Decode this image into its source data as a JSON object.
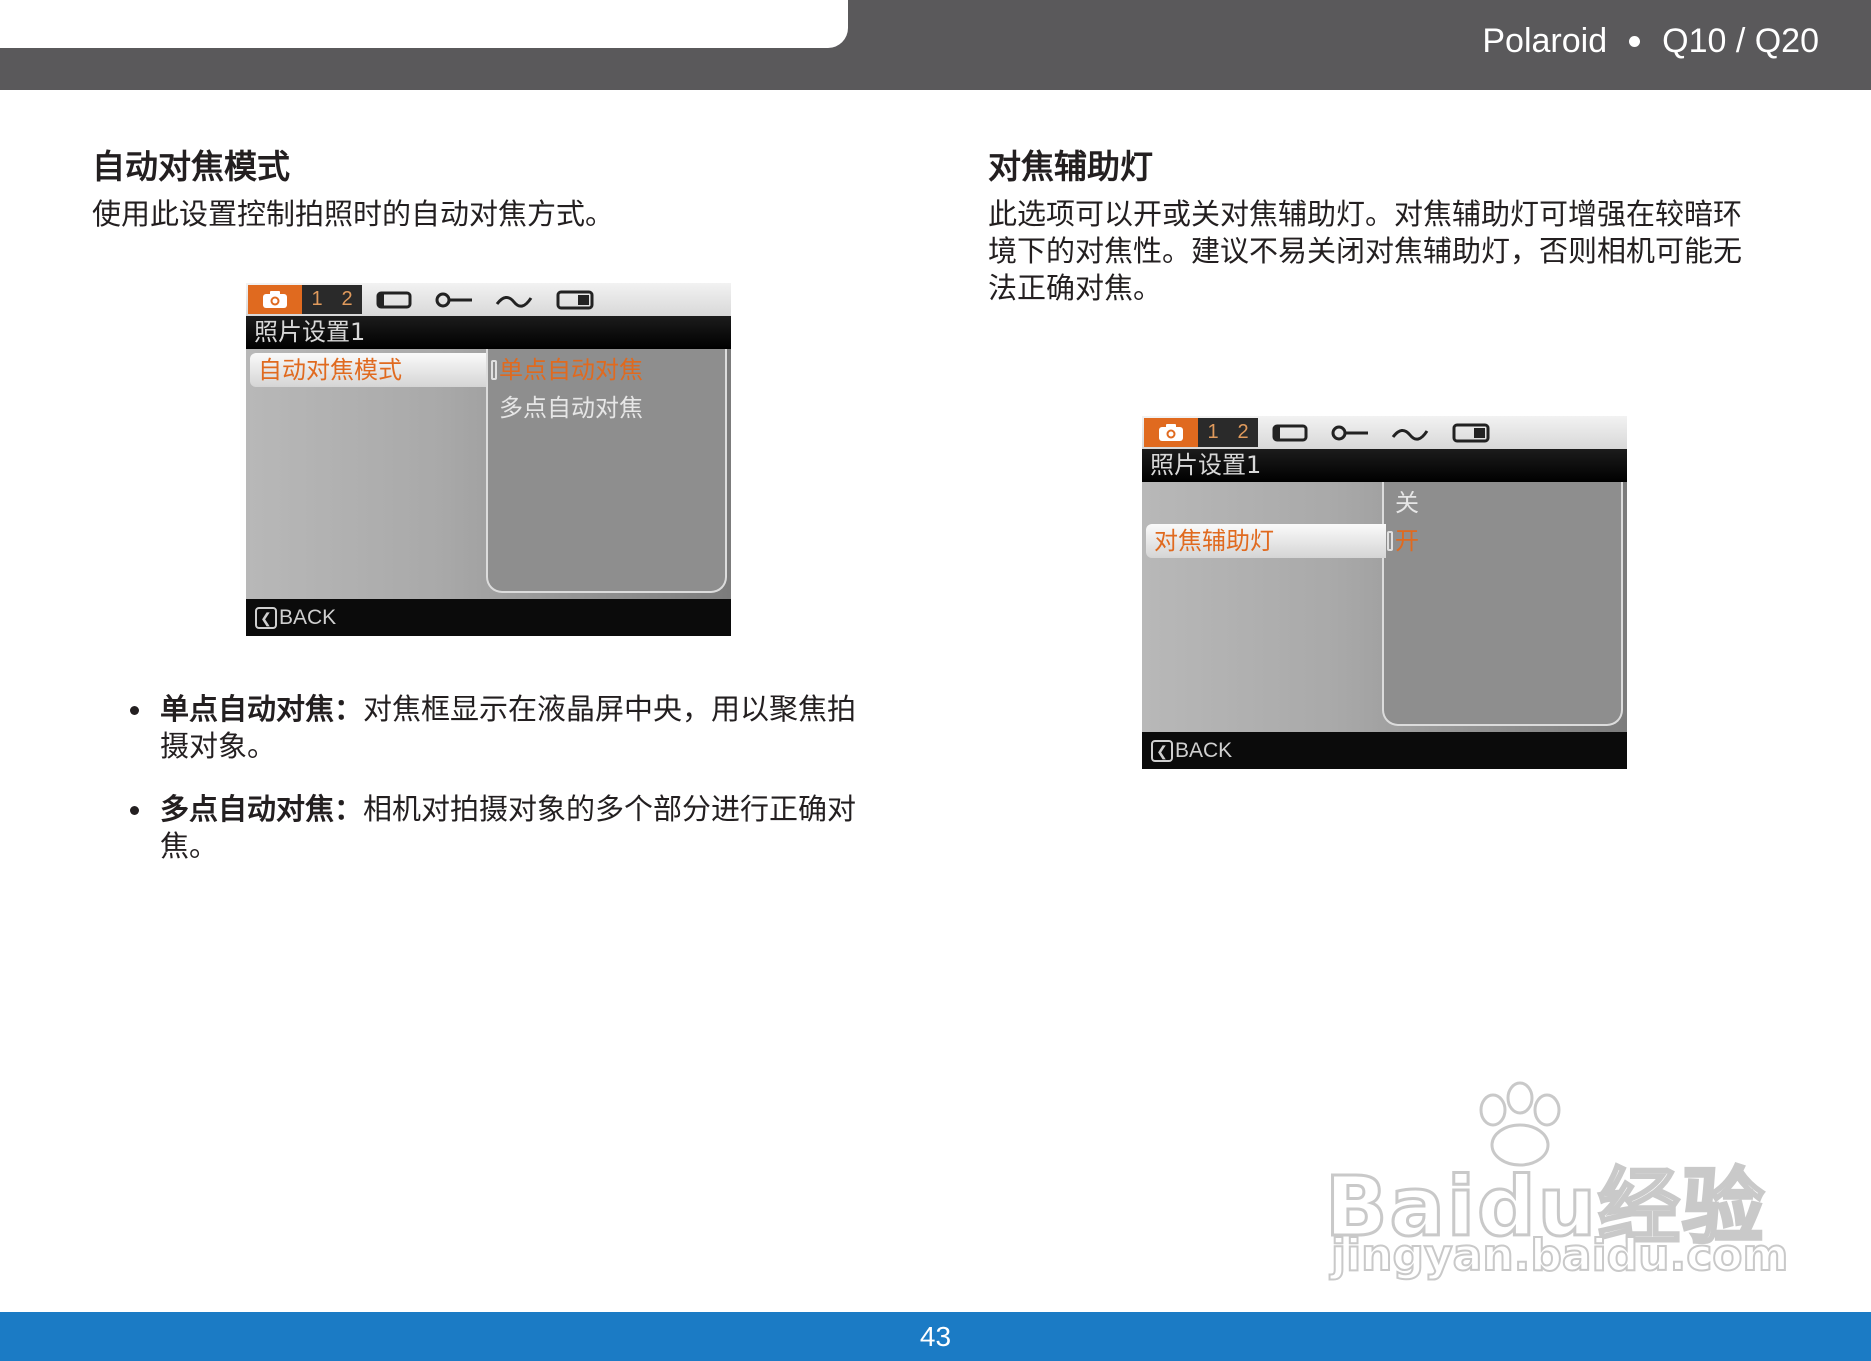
{
  "header": {
    "brand": "Polaroid",
    "model": "Q10 / Q20"
  },
  "left": {
    "title": "自动对焦模式",
    "description": "使用此设置控制拍照时的自动对焦方式。",
    "lcd": {
      "tab_numbers": [
        "1",
        "2"
      ],
      "menu_title": "照片设置1",
      "selected_item": "自动对焦模式",
      "options": [
        "单点自动对焦",
        "多点自动对焦"
      ],
      "back_label": "BACK"
    },
    "bullets": [
      {
        "term": "单点自动对焦：",
        "text": "对焦框显示在液晶屏中央，用以聚焦拍摄对象。"
      },
      {
        "term": "多点自动对焦：",
        "text": "相机对拍摄对象的多个部分进行正确对焦。"
      }
    ]
  },
  "right": {
    "title": "对焦辅助灯",
    "description": "此选项可以开或关对焦辅助灯。对焦辅助灯可增强在较暗环境下的对焦性。建议不易关闭对焦辅助灯，否则相机可能无法正确对焦。",
    "lcd": {
      "tab_numbers": [
        "1",
        "2"
      ],
      "menu_title": "照片设置1",
      "selected_item": "对焦辅助灯",
      "options": [
        "关",
        "开"
      ],
      "back_label": "BACK"
    }
  },
  "watermark": {
    "main": "Baidu经验",
    "url": "jingyan.baidu.com"
  },
  "footer": {
    "page_number": "43"
  },
  "colors": {
    "header_bg": "#5a595b",
    "footer_bg": "#1b7bc5",
    "lcd_accent": "#e06a1f"
  }
}
